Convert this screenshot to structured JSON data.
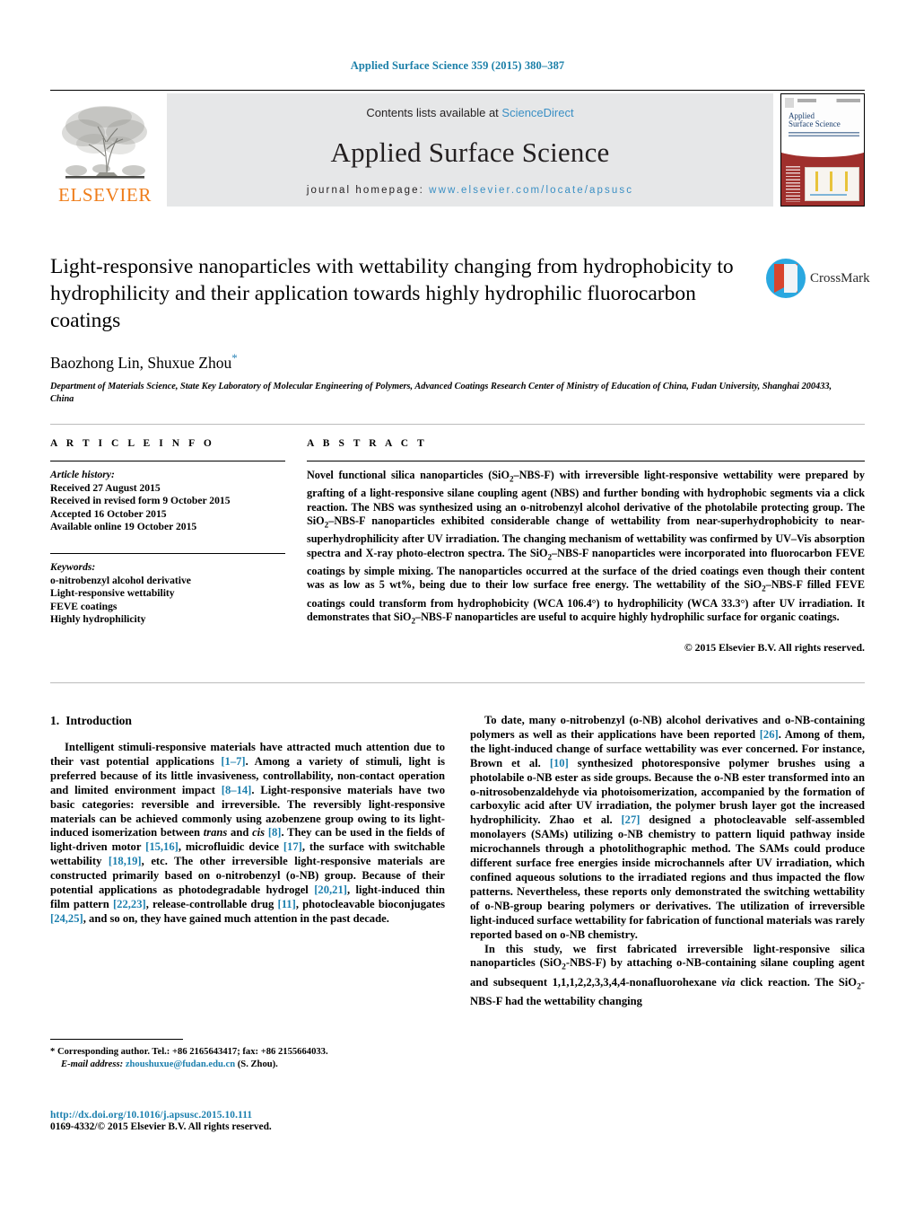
{
  "running_head": "Applied Surface Science 359 (2015) 380–387",
  "masthead": {
    "publisher_name": "ELSEVIER",
    "contents_prefix": "Contents lists available at ",
    "sciencedirect": "ScienceDirect",
    "journal_title": "Applied Surface Science",
    "homepage_prefix": "journal homepage: ",
    "homepage_url": "www.elsevier.com/locate/apsusc",
    "cover": {
      "line1": "Applied",
      "line2": "Surface Science"
    }
  },
  "article": {
    "title": "Light-responsive nanoparticles with wettability changing from hydrophobicity to hydrophilicity and their application towards highly hydrophilic fluorocarbon coatings",
    "authors": "Baozhong Lin, Shuxue Zhou",
    "author_marker": "*",
    "affiliation": "Department of Materials Science, State Key Laboratory of Molecular Engineering of Polymers, Advanced Coatings Research Center of Ministry of Education of China, Fudan University, Shanghai 200433, China",
    "crossmark_label": "CrossMark"
  },
  "info": {
    "heading": "A R T I C L E   I N F O",
    "history_label": "Article history:",
    "history": [
      "Received 27 August 2015",
      "Received in revised form 9 October 2015",
      "Accepted 16 October 2015",
      "Available online 19 October 2015"
    ],
    "keywords_label": "Keywords:",
    "keywords": [
      "o-nitrobenzyl alcohol derivative",
      "Light-responsive wettability",
      "FEVE coatings",
      "Highly hydrophilicity"
    ]
  },
  "abstract": {
    "heading": "A B S T R A C T",
    "text_parts": [
      "Novel functional silica nanoparticles (SiO",
      "2",
      "–NBS-F) with irreversible light-responsive wettability were prepared by grafting of a light-responsive silane coupling agent (NBS) and further bonding with hydrophobic segments via a click reaction. The NBS was synthesized using an o-nitrobenzyl alcohol derivative of the photolabile protecting group. The SiO",
      "2",
      "–NBS-F nanoparticles exhibited considerable change of wettability from near-superhydrophobicity to near-superhydrophilicity after UV irradiation. The changing mechanism of wettability was confirmed by UV–Vis absorption spectra and X-ray photo-electron spectra. The SiO",
      "2",
      "–NBS-F nanoparticles were incorporated into fluorocarbon FEVE coatings by simple mixing. The nanoparticles occurred at the surface of the dried coatings even though their content was as low as 5 wt%, being due to their low surface free energy. The wettability of the SiO",
      "2",
      "–NBS-F filled FEVE coatings could transform from hydrophobicity (WCA 106.4°) to hydrophilicity (WCA 33.3°) after UV irradiation. It demonstrates that SiO",
      "2",
      "–NBS-F nanoparticles are useful to acquire highly hydrophilic surface for organic coatings."
    ],
    "copyright": "© 2015 Elsevier B.V. All rights reserved."
  },
  "body": {
    "section_number": "1.",
    "section_title": "Introduction",
    "left_paragraphs": [
      {
        "segments": [
          {
            "t": "Intelligent stimuli-responsive materials have attracted much attention due to their vast potential applications ",
            "s": "plain"
          },
          {
            "t": "[1–7]",
            "s": "ref"
          },
          {
            "t": ". Among a variety of stimuli, light is preferred because of its little invasiveness, controllability, non-contact operation and limited environment impact ",
            "s": "plain"
          },
          {
            "t": "[8–14]",
            "s": "ref"
          },
          {
            "t": ". Light-responsive materials have two basic categories: reversible and irreversible. The reversibly light-responsive materials can be achieved commonly using azobenzene group owing to its light-induced isomerization between ",
            "s": "plain"
          },
          {
            "t": "trans",
            "s": "ital"
          },
          {
            "t": " and ",
            "s": "plain"
          },
          {
            "t": "cis",
            "s": "ital"
          },
          {
            "t": " ",
            "s": "plain"
          },
          {
            "t": "[8]",
            "s": "ref"
          },
          {
            "t": ". They can be used in the fields of light-driven motor ",
            "s": "plain"
          },
          {
            "t": "[15,16]",
            "s": "ref"
          },
          {
            "t": ", microfluidic device ",
            "s": "plain"
          },
          {
            "t": "[17]",
            "s": "ref"
          },
          {
            "t": ", the surface with switchable wettability ",
            "s": "plain"
          },
          {
            "t": "[18,19]",
            "s": "ref"
          },
          {
            "t": ", etc. The other irreversible light-responsive materials are constructed primarily based on o-nitrobenzyl (o-NB) group. Because of their potential applications as photodegradable hydrogel ",
            "s": "plain"
          },
          {
            "t": "[20,21]",
            "s": "ref"
          },
          {
            "t": ", light-induced thin film pattern ",
            "s": "plain"
          },
          {
            "t": "[22,23]",
            "s": "ref"
          },
          {
            "t": ", release-controllable drug ",
            "s": "plain"
          },
          {
            "t": "[11]",
            "s": "ref"
          },
          {
            "t": ", photocleavable bioconjugates ",
            "s": "plain"
          },
          {
            "t": "[24,25]",
            "s": "ref"
          },
          {
            "t": ", and so on, they have gained much attention in the past decade.",
            "s": "plain"
          }
        ]
      }
    ],
    "right_paragraphs": [
      {
        "segments": [
          {
            "t": "To date, many o-nitrobenzyl (o-NB) alcohol derivatives and o-NB-containing polymers as well as their applications have been reported ",
            "s": "plain"
          },
          {
            "t": "[26]",
            "s": "ref"
          },
          {
            "t": ". Among of them, the light-induced change of surface wettability was ever concerned. For instance, Brown et al. ",
            "s": "plain"
          },
          {
            "t": "[10]",
            "s": "ref"
          },
          {
            "t": " synthesized photoresponsive polymer brushes using a photolabile o-NB ester as side groups. Because the o-NB ester transformed into an o-nitrosobenzaldehyde via photoisomerization, accompanied by the formation of carboxylic acid after UV irradiation, the polymer brush layer got the increased hydrophilicity. Zhao et al. ",
            "s": "plain"
          },
          {
            "t": "[27]",
            "s": "ref"
          },
          {
            "t": " designed a photocleavable self-assembled monolayers (SAMs) utilizing o-NB chemistry to pattern liquid pathway inside microchannels through a photolithographic method. The SAMs could produce different surface free energies inside microchannels after UV irradiation, which confined aqueous solutions to the irradiated regions and thus impacted the flow patterns. Nevertheless, these reports only demonstrated the switching wettability of o-NB-group bearing polymers or derivatives. The utilization of irreversible light-induced surface wettability for fabrication of functional materials was rarely reported based on o-NB chemistry.",
            "s": "plain"
          }
        ]
      },
      {
        "segments": [
          {
            "t": "In this study, we first fabricated irreversible light-responsive silica nanoparticles (SiO",
            "s": "plain"
          },
          {
            "t": "2",
            "s": "sub"
          },
          {
            "t": "-NBS-F) by attaching o-NB-containing silane coupling agent and subsequent 1,1,1,2,2,3,3,4,4-nonafluorohexane ",
            "s": "plain"
          },
          {
            "t": "via",
            "s": "ital"
          },
          {
            "t": " click reaction. The SiO",
            "s": "plain"
          },
          {
            "t": "2",
            "s": "sub"
          },
          {
            "t": "-NBS-F had the wettability changing",
            "s": "plain"
          }
        ]
      }
    ]
  },
  "footnote": {
    "marker": "*",
    "line1": " Corresponding author. Tel.: +86 2165643417; fax: +86 2155664033.",
    "email_label": "E-mail address:",
    "email": "zhoushuxue@fudan.edu.cn",
    "email_suffix": " (S. Zhou)."
  },
  "footer": {
    "doi": "http://dx.doi.org/10.1016/j.apsusc.2015.10.111",
    "issn_line": "0169-4332/© 2015 Elsevier B.V. All rights reserved."
  },
  "colors": {
    "link": "#1b7fae",
    "running_head": "#1a7fa8",
    "elsevier_orange": "#ef7d1a",
    "panel_grey": "#e6e7e8"
  }
}
